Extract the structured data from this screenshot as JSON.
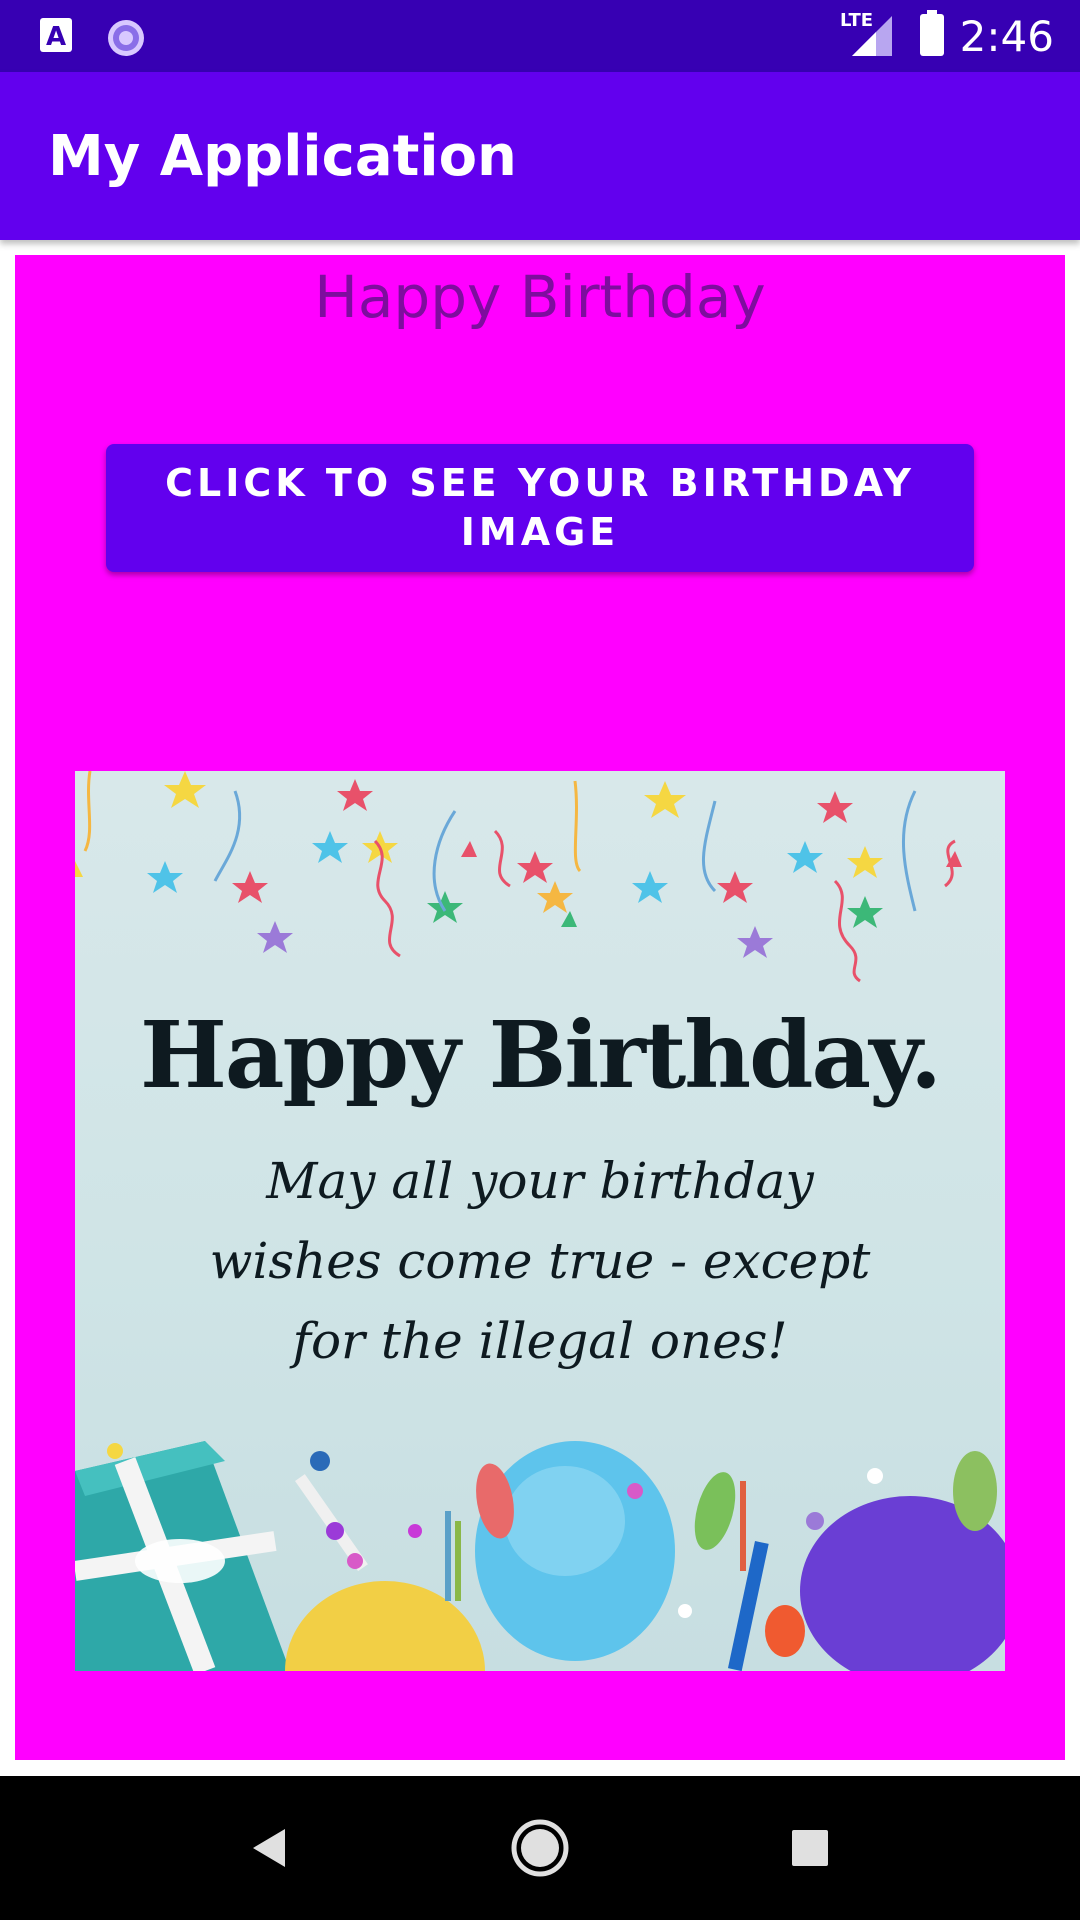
{
  "status_bar": {
    "time": "2:46",
    "network": "LTE",
    "icons": [
      "accessibility-a-icon",
      "loading-spinner-icon",
      "lte-signal-icon",
      "battery-icon"
    ]
  },
  "app_bar": {
    "title": "My Application"
  },
  "main": {
    "heading": "Happy Birthday",
    "button_label": "CLICK TO SEE YOUR BIRTHDAY IMAGE",
    "card": {
      "title": "Happy Birthday.",
      "message": "May all your birthday wishes come true - except for the illegal ones!"
    }
  },
  "nav_bar": {
    "icons": [
      "back-icon",
      "home-icon",
      "recents-icon"
    ]
  },
  "colors": {
    "status_bar": "#3700b3",
    "app_bar": "#6200ee",
    "background": "#ff00ff",
    "heading_text": "#7e0d9e",
    "button": "#6200ee"
  }
}
